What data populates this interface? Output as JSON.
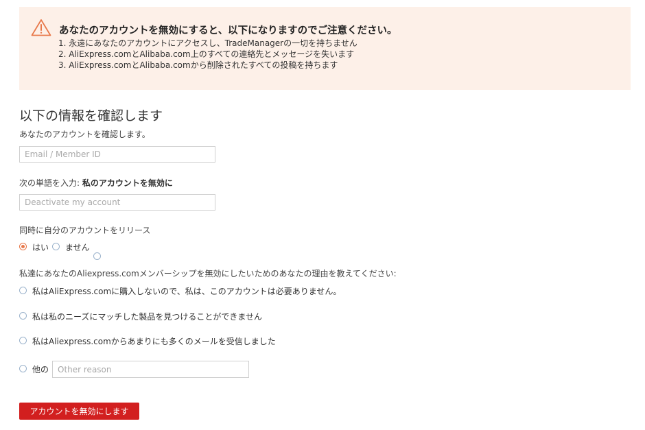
{
  "warning": {
    "icon": "warning-triangle-icon",
    "icon_color": "#e8784a",
    "background": "#fdf0e8",
    "title": "あなたのアカウントを無効にすると、以下になりますのでご注意ください。",
    "items": [
      "1. 永遠にあなたのアカウントにアクセスし、TradeManagerの一切を持ちません",
      "2. AliExpress.comとAlibaba.com上のすべての連絡先とメッセージを失います",
      "3. AliExpress.comとAlibaba.comから削除されたすべての投稿を持ちます"
    ]
  },
  "form": {
    "section_title": "以下の情報を確認します",
    "confirm_label": "あなたのアカウントを確認します。",
    "email_placeholder": "Email / Member ID",
    "phrase_label": "次の単語を入力:",
    "phrase_value": "私のアカウントを無効に",
    "phrase_placeholder": "Deactivate my account",
    "release_label": "同時に自分のアカウントをリリース",
    "release_options": [
      {
        "label": "はい",
        "checked": true
      },
      {
        "label": "ません",
        "checked": false
      }
    ],
    "reason_label": "私達にあなたのAliexpress.comメンバーシップを無効にしたいためのあなたの理由を教えてください:",
    "reasons": [
      {
        "label": "私はAliExpress.comに購入しないので、私は、このアカウントは必要ありません。"
      },
      {
        "label": "私は私のニーズにマッチした製品を見つけることができません"
      },
      {
        "label": "私はAliexpress.comからあまりにも多くのメールを受信しました"
      },
      {
        "label": "他の"
      }
    ],
    "other_placeholder": "Other reason",
    "submit_label": "アカウントを無効にします",
    "submit_color": "#d21f1f",
    "radio_accent": "#e8784a"
  }
}
